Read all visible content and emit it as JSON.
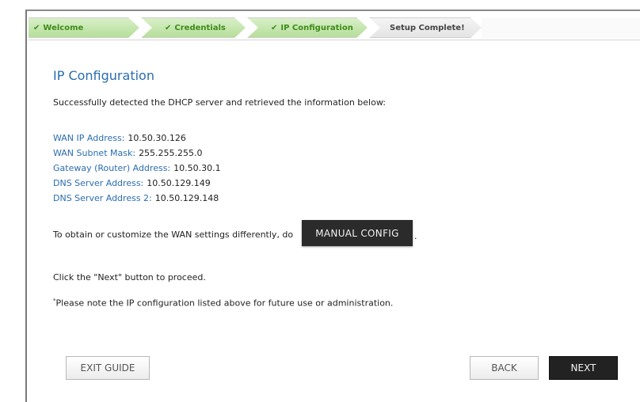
{
  "wizard_steps": [
    {
      "label": "Welcome",
      "state": "done"
    },
    {
      "label": "Credentials",
      "state": "done"
    },
    {
      "label": "IP Configuration",
      "state": "done"
    },
    {
      "label": "Setup Complete!",
      "state": "current"
    }
  ],
  "page": {
    "title": "IP Configuration",
    "intro": "Successfully detected the DHCP server and retrieved the information below:"
  },
  "ip_info": [
    {
      "label": "WAN IP Address:",
      "value": "10.50.30.126"
    },
    {
      "label": "WAN Subnet Mask:",
      "value": "255.255.255.0"
    },
    {
      "label": "Gateway (Router) Address:",
      "value": "10.50.30.1"
    },
    {
      "label": "DNS Server Address:",
      "value": "10.50.129.149"
    },
    {
      "label": "DNS Server Address 2:",
      "value": "10.50.129.148"
    }
  ],
  "manual": {
    "prefix": "To obtain or customize the WAN settings differently, do",
    "button_label": "MANUAL CONFIG",
    "suffix": "."
  },
  "proceed_text": "Click the \"Next\" button to proceed.",
  "note": {
    "star": "*",
    "text": "Please note the IP configuration listed above for future use or administration."
  },
  "buttons": {
    "exit": "EXIT GUIDE",
    "back": "BACK",
    "next": "NEXT"
  },
  "colors": {
    "accent_blue": "#2a6db0",
    "step_done_green": "#3d8c1a",
    "dark_button": "#222222"
  },
  "icons": {
    "step_check": "✔"
  }
}
